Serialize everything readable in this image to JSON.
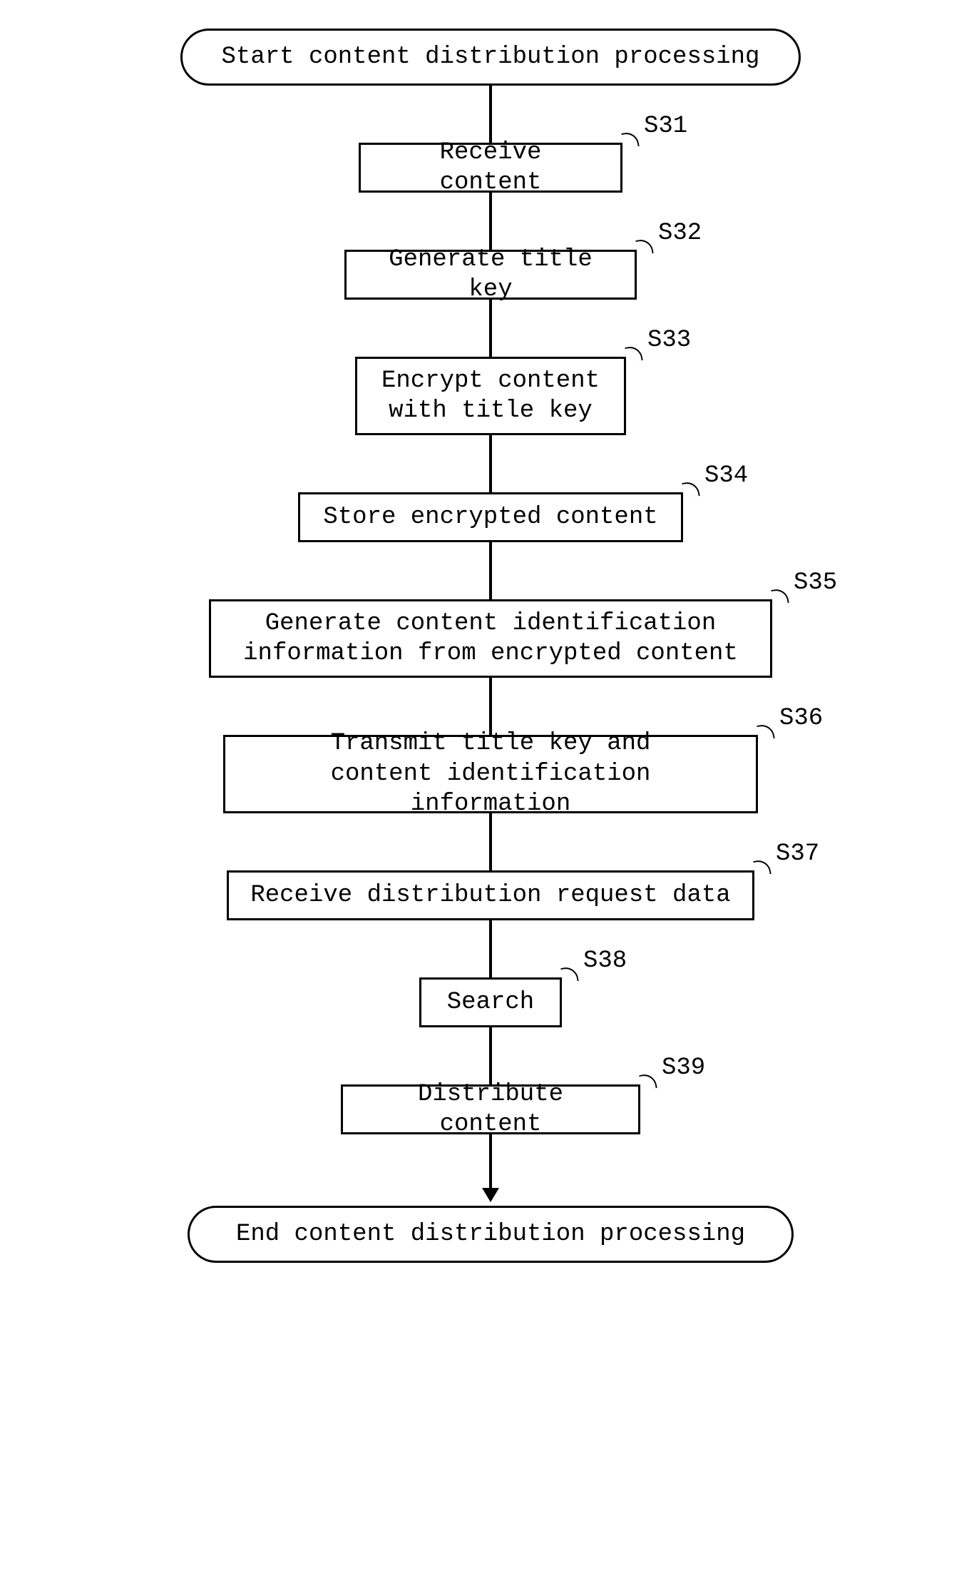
{
  "flowchart": {
    "start": "Start content distribution processing",
    "end": "End content distribution processing",
    "steps": [
      {
        "id": "S31",
        "text": "Receive content"
      },
      {
        "id": "S32",
        "text": "Generate title key"
      },
      {
        "id": "S33",
        "text": "Encrypt content\nwith title key"
      },
      {
        "id": "S34",
        "text": "Store encrypted content"
      },
      {
        "id": "S35",
        "text": "Generate content identification\ninformation from encrypted content"
      },
      {
        "id": "S36",
        "text": "Transmit title key and\ncontent identification information"
      },
      {
        "id": "S37",
        "text": "Receive distribution request data"
      },
      {
        "id": "S38",
        "text": "Search"
      },
      {
        "id": "S39",
        "text": "Distribute content"
      }
    ]
  }
}
